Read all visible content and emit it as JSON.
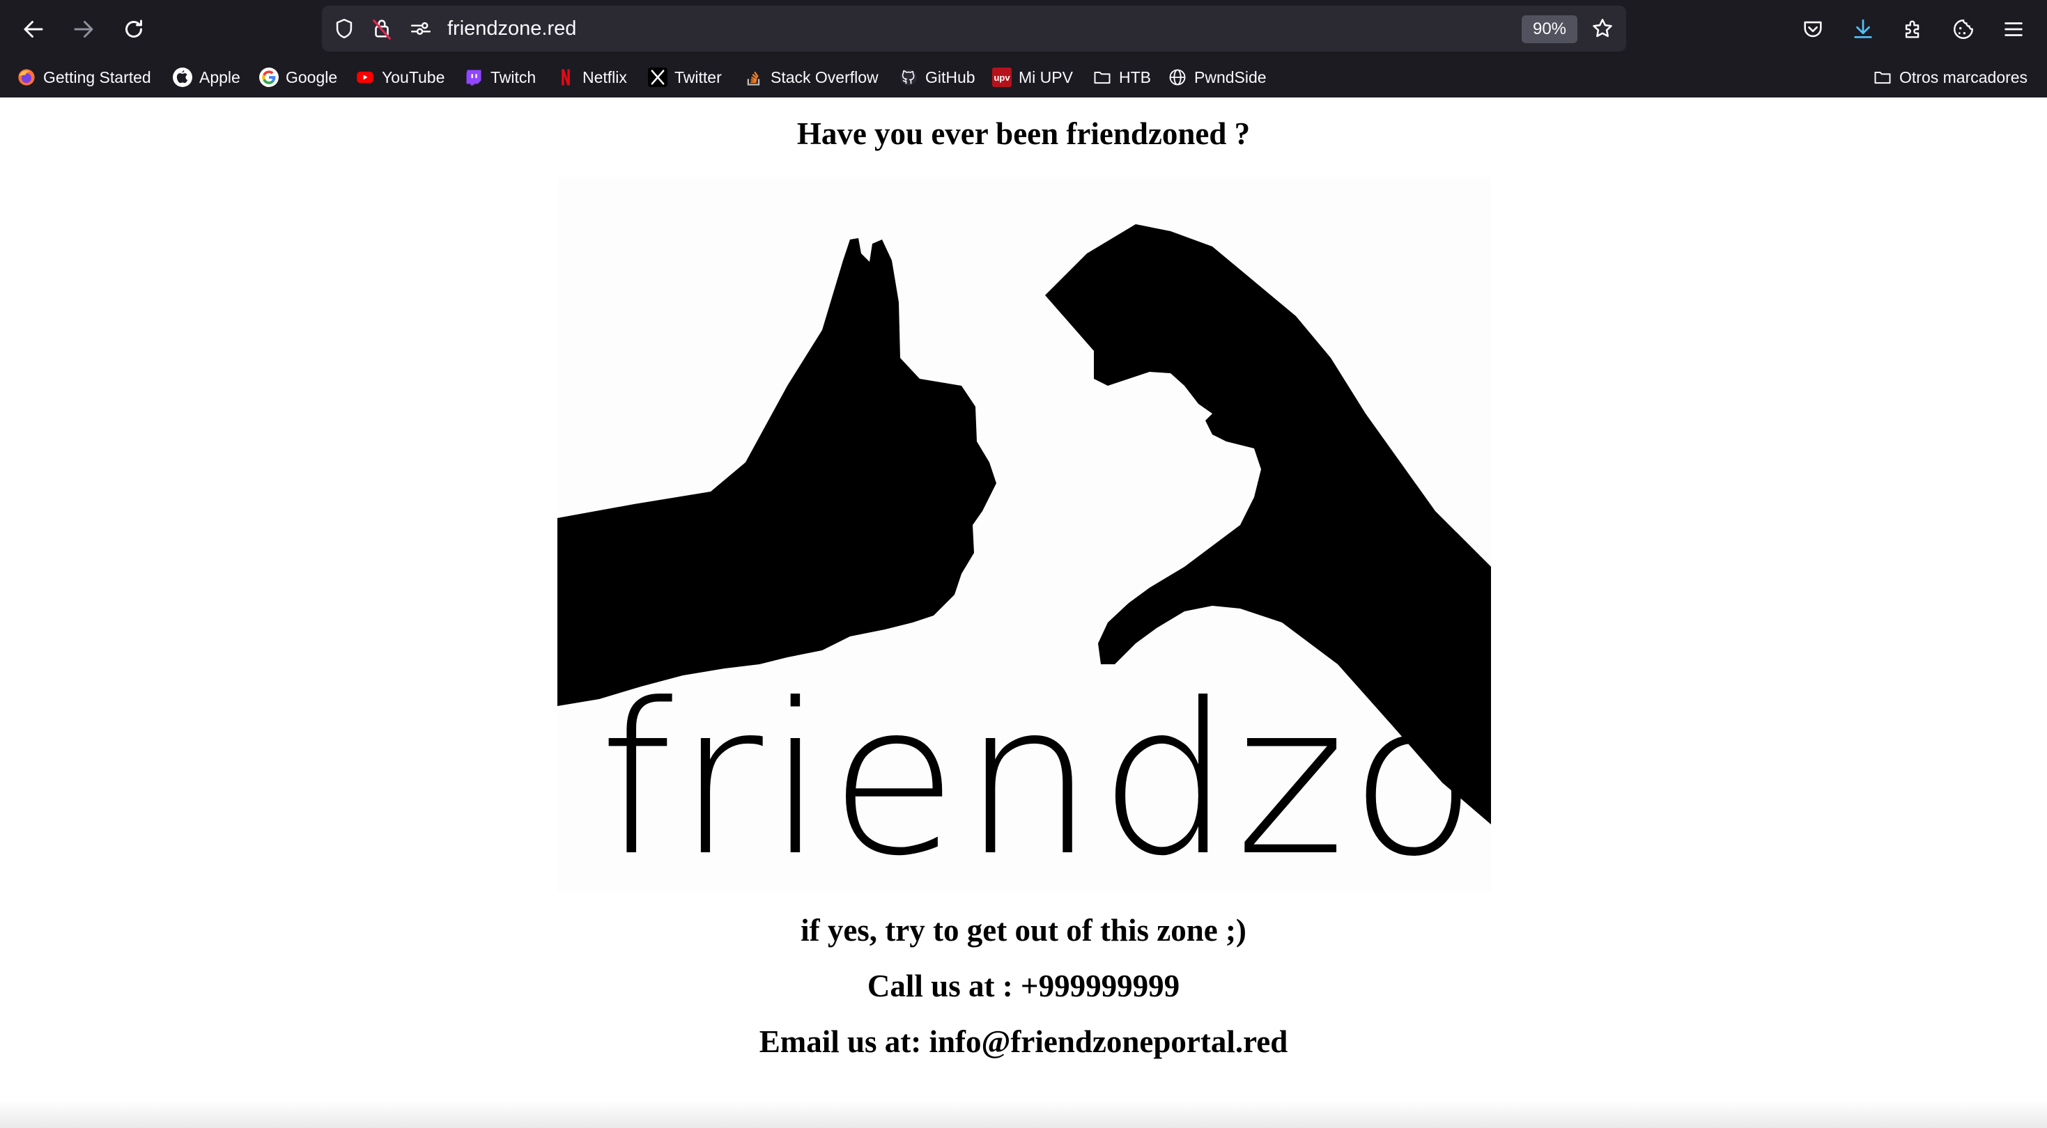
{
  "browser": {
    "url": "friendzone.red",
    "zoom": "90%",
    "bookmarks": [
      {
        "label": "Getting Started",
        "icon": "firefox-icon"
      },
      {
        "label": "Apple",
        "icon": "apple-icon"
      },
      {
        "label": "Google",
        "icon": "google-icon"
      },
      {
        "label": "YouTube",
        "icon": "youtube-icon"
      },
      {
        "label": "Twitch",
        "icon": "twitch-icon"
      },
      {
        "label": "Netflix",
        "icon": "netflix-icon"
      },
      {
        "label": "Twitter",
        "icon": "x-icon"
      },
      {
        "label": "Stack Overflow",
        "icon": "stackoverflow-icon"
      },
      {
        "label": "GitHub",
        "icon": "github-icon"
      },
      {
        "label": "Mi UPV",
        "icon": "upv-icon"
      },
      {
        "label": "HTB",
        "icon": "folder-icon"
      },
      {
        "label": "PwndSide",
        "icon": "globe-icon"
      }
    ],
    "other_bookmarks": "Otros marcadores"
  },
  "page": {
    "title": "Have you ever been friendzoned ?",
    "logo_text": "friendzone",
    "line1": "if yes, try to get out of this zone ;)",
    "line2": "Call us at : +999999999",
    "line3": "Email us at: info@friendzoneportal.red"
  },
  "colors": {
    "chrome_bg": "#1c1b22",
    "urlbar_bg": "#2b2a33",
    "download_accent": "#54ffbd"
  }
}
